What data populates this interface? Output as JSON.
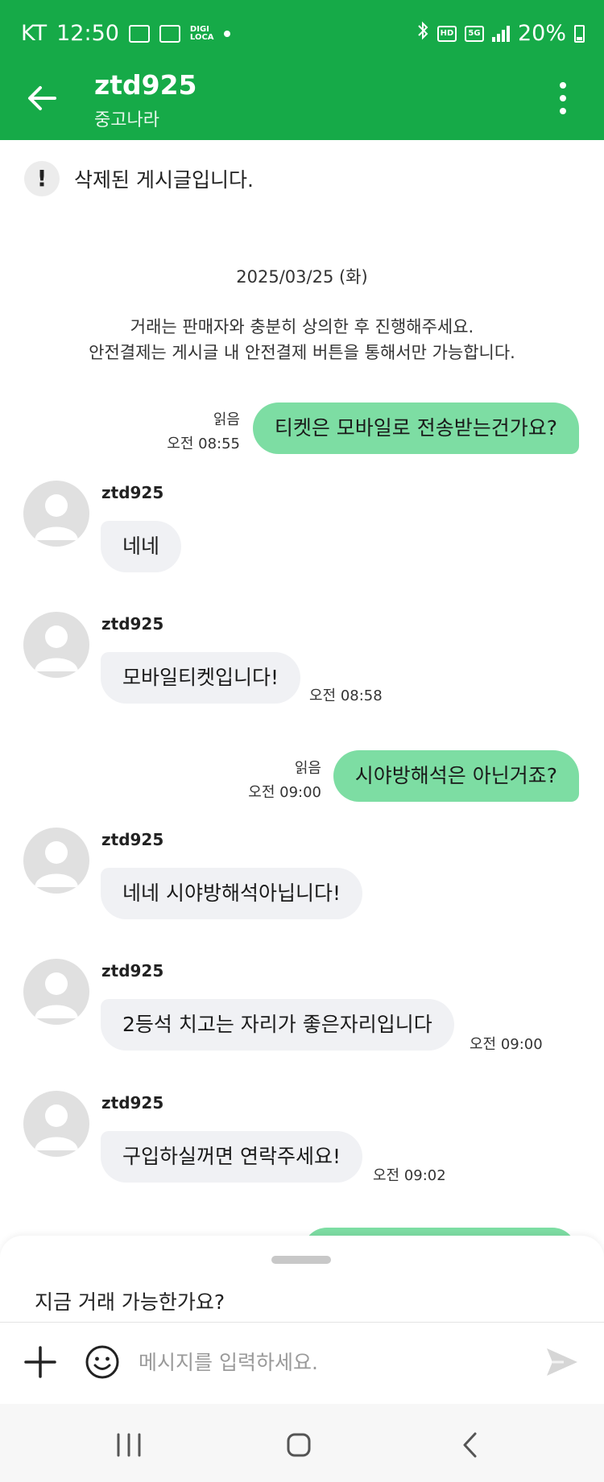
{
  "status_bar": {
    "carrier": "KT",
    "time": "12:50",
    "digi_line1": "DIGI",
    "digi_line2": "LOCA",
    "hd": "HD",
    "network": "5G",
    "battery": "20%"
  },
  "header": {
    "title": "ztd925",
    "subtitle": "중고나라"
  },
  "notice": {
    "icon": "!",
    "text": "삭제된 게시글입니다."
  },
  "date_divider": "2025/03/25 (화)",
  "guide": {
    "line1": "거래는 판매자와 충분히 상의한 후 진행해주세요.",
    "line2": "안전결제는 게시글 내 안전결제 버튼을 통해서만 가능합니다."
  },
  "messages": [
    {
      "side": "out",
      "read": "읽음",
      "time": "오전 08:55",
      "text": "티켓은 모바일로 전송받는건가요?"
    },
    {
      "side": "in",
      "sender": "ztd925",
      "text": "네네",
      "time": ""
    },
    {
      "side": "in",
      "sender": "ztd925",
      "text": "모바일티켓입니다!",
      "time": "오전 08:58"
    },
    {
      "side": "out",
      "read": "읽음",
      "time": "오전 09:00",
      "text": "시야방해석은 아닌거죠?"
    },
    {
      "side": "in",
      "sender": "ztd925",
      "text": "네네 시야방해석아닙니다!",
      "time": ""
    },
    {
      "side": "in",
      "sender": "ztd925",
      "text": "2등석 치고는 자리가 좋은자리입니다",
      "time": "오전 09:00"
    },
    {
      "side": "in",
      "sender": "ztd925",
      "text": "구입하실꺼면 연락주세요!",
      "time": "오전 09:02"
    }
  ],
  "composer": {
    "suggestion": "지금 거래 가능한가요?",
    "placeholder": "메시지를 입력하세요."
  },
  "colors": {
    "brand_green": "#16aa48",
    "outgoing_bubble": "#7ddda3",
    "incoming_bubble": "#f0f1f4"
  },
  "icons": [
    "back-arrow-icon",
    "more-vertical-icon",
    "plus-icon",
    "emoji-icon",
    "send-icon",
    "recent-apps-icon",
    "home-icon",
    "nav-back-icon"
  ]
}
